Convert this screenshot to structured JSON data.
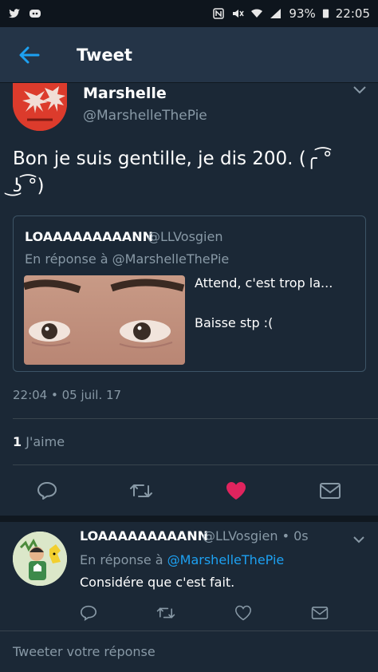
{
  "status_bar": {
    "battery": "93%",
    "time": "22:05"
  },
  "header": {
    "title": "Tweet"
  },
  "tweet": {
    "author_name": "Marshelle",
    "author_handle": "@MarshelleThePie",
    "text": "Bon je suis gentille, je dis 200. (╭ ͡ ͡ ╮ ͜ʖ ͡ ͡ )",
    "text_line1": "Bon je suis gentille, je dis 200. (╭ ͡°",
    "text_line2": "͜ʖ ͡°)",
    "quoted": {
      "author_name": "LOAAAAAAAAANN",
      "author_handle": "@LLVosgien",
      "reply_to": "En réponse à @MarshelleThePie",
      "text_line1": "Attend, c'est trop la...",
      "text_line2": "Baisse stp :("
    },
    "timestamp": "22:04 • 05 juil. 17",
    "likes_count": "1",
    "likes_label": "J'aime",
    "liked": true
  },
  "reply": {
    "author_name": "LOAAAAAAAAANN",
    "author_handle": "@LLVosgien • 0s",
    "reply_prefix": "En réponse à ",
    "reply_to": "@MarshelleThePie",
    "text": "Considére que c'est fait."
  },
  "compose": {
    "placeholder": "Tweeter votre réponse"
  },
  "colors": {
    "background": "#1b2836",
    "header": "#243447",
    "accent": "#1da1f2",
    "like": "#e0245e",
    "muted": "#8899a6"
  }
}
